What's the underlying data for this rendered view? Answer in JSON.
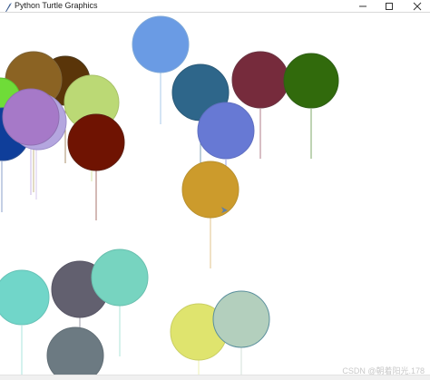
{
  "window": {
    "title": "Python Turtle Graphics",
    "controls": [
      "minimize",
      "maximize",
      "close"
    ]
  },
  "title_icon": "feather-icon",
  "canvas": {
    "background": "#ffffff",
    "balloon_count": 21,
    "balloon_colors": [
      "#6a9be4",
      "#5a3509",
      "#8b6323",
      "#6fdc38",
      "#0f3e9a",
      "#b4a6df",
      "#a679c8",
      "#bbd975",
      "#6f1302",
      "#2e668a",
      "#762b3c",
      "#316a0c",
      "#6779d4",
      "#cc9b2c",
      "#71d6c9",
      "#62606f",
      "#77d4c0",
      "#6c7a82",
      "#dfe46e",
      "#b3cfbd"
    ],
    "turtle_cursor": "arrow-icon"
  },
  "watermark": "CSDN @朝着阳光.178"
}
